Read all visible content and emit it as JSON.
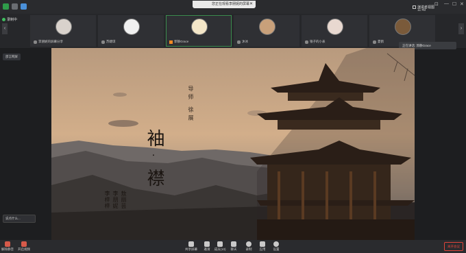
{
  "window": {
    "share_banner": "您正在观看李朋妮的屏幕",
    "time": "11:49"
  },
  "thumbnails": {
    "recording_label": "录制中",
    "view_label": "演讲者视图",
    "tiles": [
      {
        "name": "李朋妮的屏幕分享",
        "active": false,
        "avatar_color": "#d9d2cc"
      },
      {
        "name": "苏婕琼",
        "active": false,
        "avatar_color": "#f0f0f0"
      },
      {
        "name": "郭静Grace",
        "active": true,
        "avatar_color": "#f4e6c8"
      },
      {
        "name": "沐冰",
        "active": false,
        "avatar_color": "#c8a07a"
      },
      {
        "name": "银子的小表",
        "active": false,
        "avatar_color": "#e8d8d0"
      },
      {
        "name": "夏鹤",
        "active": false,
        "avatar_color": "#7a5a3a"
      }
    ]
  },
  "left_panel": {
    "speaker_chip": "邵言网屏",
    "chat_chip": "说点什么..."
  },
  "right_panel": {
    "speaking": "正在讲话: 郭静Grace"
  },
  "slide": {
    "title_1": "袖",
    "dot": "·",
    "title_2": "襟",
    "mentor": "导师 徐展",
    "students": [
      "敖丽芸",
      "李朋妮",
      "李梓梓"
    ]
  },
  "toolbar": {
    "mute": "解除静音",
    "video": "开启视频",
    "share": "共享屏幕",
    "invite": "邀请",
    "members": "成员(10)",
    "chat": "聊天",
    "record": "录制",
    "apps": "应用",
    "settings": "设置",
    "leave": "离开会议"
  }
}
